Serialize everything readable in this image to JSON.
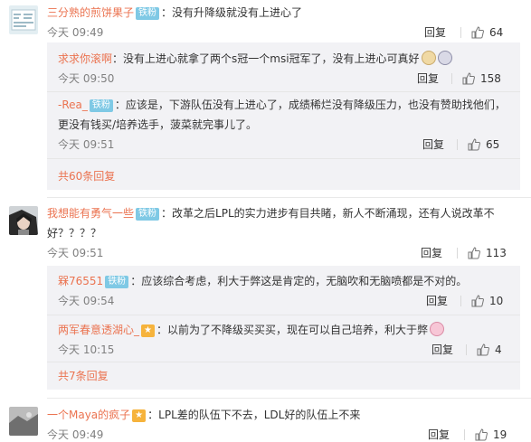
{
  "comments": [
    {
      "user": "三分熟的煎饼果子",
      "badge": "铁粉",
      "text": "：没有升降级就没有上进心了",
      "time": "今天 09:49",
      "reply": "回复",
      "likes": "64",
      "sub": [
        {
          "user": "求求你滚啊",
          "text": "：没有上进心就拿了两个s冠一个msi冠军了，没有上进心可真好",
          "time": "今天 09:50",
          "reply": "回复",
          "likes": "158"
        },
        {
          "user": "-Rea_",
          "badge": "铁粉",
          "text": "：应该是，下游队伍没有上进心了，成绩稀烂没有降级压力，也没有赞助找他们，更没有钱买/培养选手，菠菜就完事儿了。",
          "time": "今天 09:51",
          "reply": "回复",
          "likes": "65"
        }
      ],
      "more": "共60条回复"
    },
    {
      "user": "我想能有勇气一些",
      "badge": "铁粉",
      "text": "：改革之后LPL的实力进步有目共睹，新人不断涌现，还有人说改革不好？？？？",
      "time": "今天 09:51",
      "reply": "回复",
      "likes": "113",
      "sub": [
        {
          "user": "槑76551",
          "badge": "铁粉",
          "text": "：应该综合考虑，利大于弊这是肯定的，无脑吹和无脑喷都是不对的。",
          "time": "今天 09:54",
          "reply": "回复",
          "likes": "10"
        },
        {
          "user": "两军春意透湖心_",
          "text": "：以前为了不降级买买买，现在可以自己培养，利大于弊",
          "time": "今天 10:15",
          "reply": "回复",
          "likes": "4"
        }
      ],
      "more": "共7条回复"
    },
    {
      "user": "一个Maya的疯子",
      "text": "：LPL差的队伍下不去，LDL好的队伍上不来",
      "time": "今天 09:49",
      "reply": "回复",
      "likes": "19"
    }
  ],
  "colors": {
    "username": "#eb7350",
    "badge": "#7fc9e5",
    "reply_bg": "#f2f2f5"
  },
  "icons": [
    "like-icon",
    "cry-emoji-icon",
    "pig-emoji-icon",
    "vip-badge-icon"
  ]
}
